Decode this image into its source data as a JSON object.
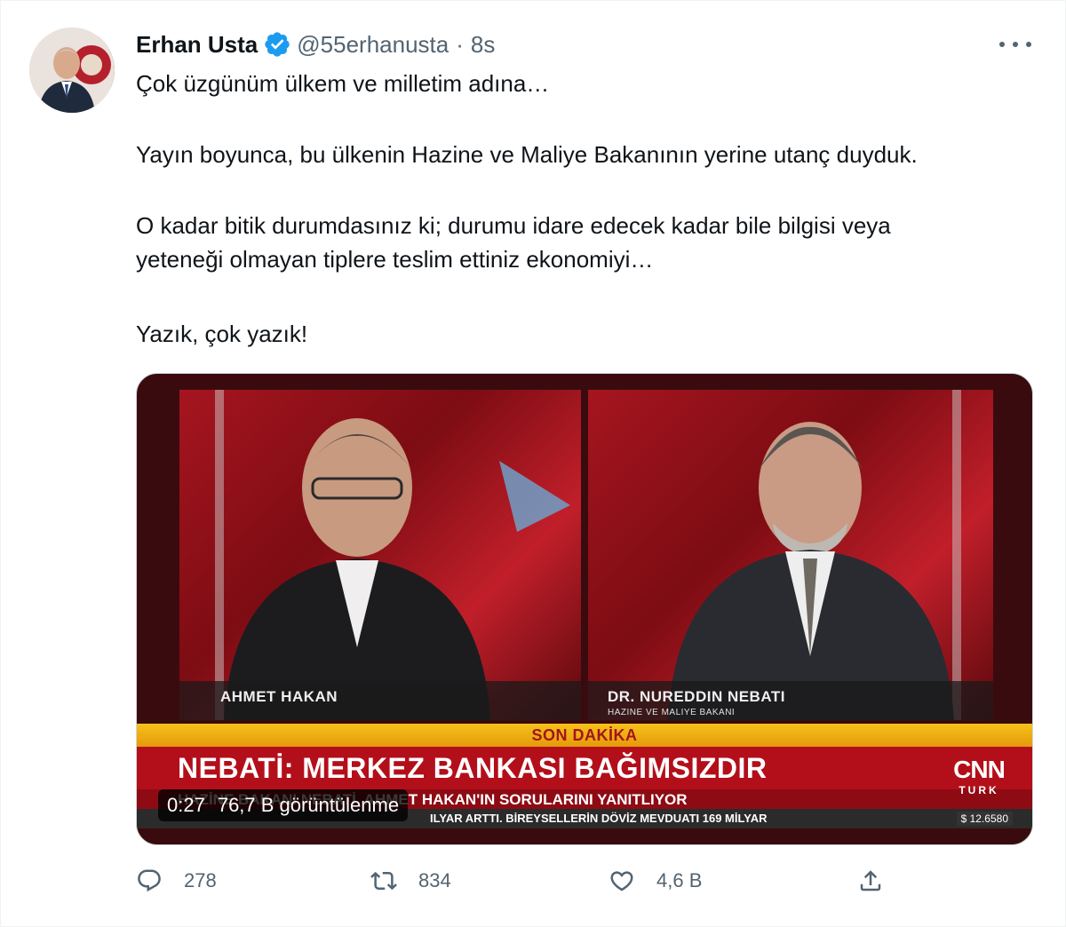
{
  "author": {
    "name": "Erhan Usta",
    "handle": "@55erhanusta",
    "separator": "·",
    "time": "8s",
    "verified": true,
    "avatar_icon": "profile-photo"
  },
  "tweet": {
    "paragraphs": [
      "Çok üzgünüm ülkem ve milletim adına…",
      "Yayın boyunca, bu ülkenin Hazine ve Maliye Bakanının yerine utanç duyduk.",
      "O kadar bitik durumdasınız ki; durumu idare edecek kadar bile bilgisi veya",
      "yeteneği olmayan tiplere teslim ettiniz ekonomiyi…",
      "Yazık, çok yazık!"
    ]
  },
  "media": {
    "left_name": "AHMET HAKAN",
    "right_name": "DR. NUREDDIN NEBATI",
    "right_title": "HAZINE VE MALIYE BAKANI",
    "ticker_label": "SON DAKİKA",
    "headline": "NEBATİ: MERKEZ BANKASI BAĞIMSIZDIR",
    "subline": "HAZİNE BAKANI NEBATİ, AHMET HAKAN'IN SORULARINI YANITLIYOR",
    "bottom_line": "ILYAR ARTTI. BİREYSELLERİN DÖVİZ MEVDUATI 169 MİLYAR",
    "channel_top": "CNN",
    "channel_bottom": "TURK",
    "fx": "$ 12.6580",
    "duration": "0:27",
    "views": "76,7 B görüntülenme"
  },
  "actions": {
    "replies": "278",
    "retweets": "834",
    "likes": "4,6 B"
  },
  "colors": {
    "verified": "#1d9bf0",
    "secondary_text": "#536471",
    "ticker_red": "#b30f1a",
    "ticker_yellow": "#f5c21a"
  }
}
